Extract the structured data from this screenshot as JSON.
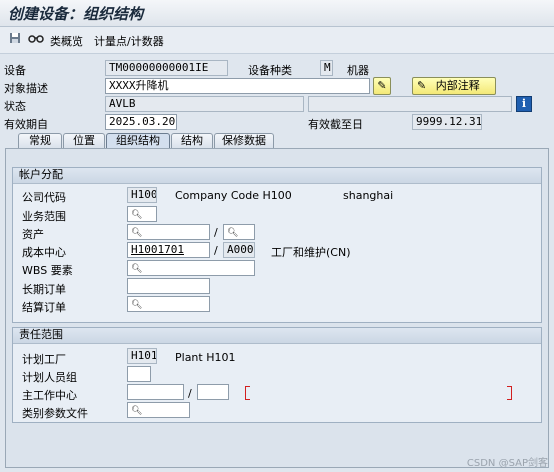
{
  "window": {
    "title": "创建设备：组织结构"
  },
  "toolbar": {
    "icons": [
      "save-icon",
      "glasses-icon"
    ],
    "class_overview": "类概览",
    "meas_points": "计量点/计数器"
  },
  "header": {
    "equipment_label": "设备",
    "equipment_value": "TM00000000001IE",
    "equip_category_label": "设备种类",
    "equip_category_value": "M",
    "equip_category_text": "机器",
    "desc_label": "对象描述",
    "desc_value": "XXXX升降机",
    "internal_note": "内部注释",
    "status_label": "状态",
    "status_value": "AVLB",
    "valid_from_label": "有效期自",
    "valid_from_value": "2025.03.20",
    "valid_to_label": "有效截至日",
    "valid_to_value": "9999.12.31"
  },
  "tabs": [
    {
      "label": "常规"
    },
    {
      "label": "位置"
    },
    {
      "label": "组织结构",
      "active": true
    },
    {
      "label": "结构"
    },
    {
      "label": "保修数据"
    }
  ],
  "account": {
    "title": "帐户分配",
    "company_code_label": "公司代码",
    "company_code_value": "H100",
    "company_code_text": "Company Code H100",
    "company_city": "shanghai",
    "business_area_label": "业务范围",
    "asset_label": "资产",
    "asset_sep": "/",
    "cost_center_label": "成本中心",
    "cost_center_value": "H1001701",
    "cost_center_sep": "/",
    "controlling_area": "A000",
    "cost_center_text": "工厂和维护(CN)",
    "wbs_label": "WBS 要素",
    "standing_order_label": "长期订单",
    "settlement_order_label": "结算订单"
  },
  "responsibility": {
    "title": "责任范围",
    "plan_plant_label": "计划工厂",
    "plan_plant_value": "H101",
    "plan_plant_text": "Plant H101",
    "planner_group_label": "计划人员组",
    "main_wc_label": "主工作中心",
    "main_wc_sep": "/",
    "catalog_profile_label": "类别参数文件"
  },
  "watermark": "CSDN @SAP剑客",
  "colors": {
    "background": "#dfe6ee",
    "button_yellow": "#f3e877",
    "info_blue": "#1f5fb0",
    "cursor_red": "#d21f1f"
  }
}
